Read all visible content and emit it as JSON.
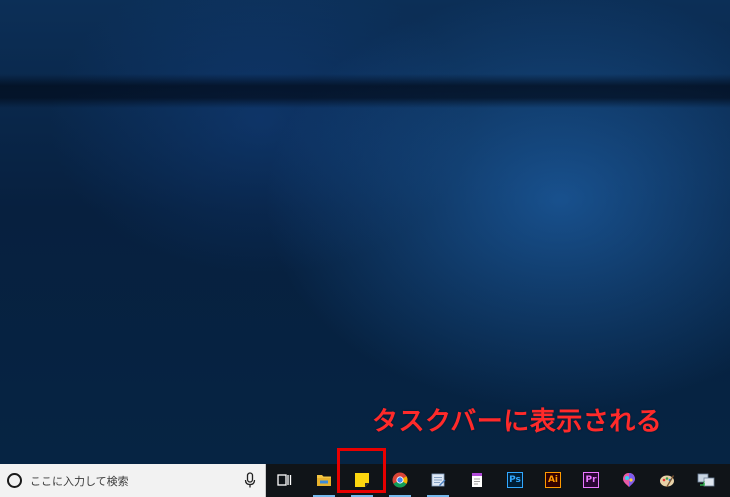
{
  "annotation": {
    "text": "タスクバーに表示される",
    "color": "#ff2a2a"
  },
  "taskbar": {
    "search_placeholder": "ここに入力して検索",
    "search_icon": "cortana-circle-icon",
    "mic_icon": "microphone-icon",
    "items": [
      {
        "name": "task-view-icon"
      },
      {
        "name": "file-explorer-icon",
        "running": true
      },
      {
        "name": "sticky-notes-icon",
        "running": true,
        "highlighted": true
      },
      {
        "name": "chrome-icon",
        "running": true
      },
      {
        "name": "notepad-app-icon",
        "running": true
      },
      {
        "name": "document-app-icon"
      },
      {
        "name": "photoshop-icon",
        "label": "Ps"
      },
      {
        "name": "illustrator-icon",
        "label": "Ai"
      },
      {
        "name": "premiere-icon",
        "label": "Pr"
      },
      {
        "name": "paint3d-icon"
      },
      {
        "name": "paint-icon"
      },
      {
        "name": "remote-app-icon"
      }
    ]
  },
  "colors": {
    "taskbar_bg": "#101418",
    "highlight": "#e80000",
    "photoshop": "#31a8ff",
    "illustrator": "#ff9a00",
    "premiere": "#ea77ff"
  }
}
